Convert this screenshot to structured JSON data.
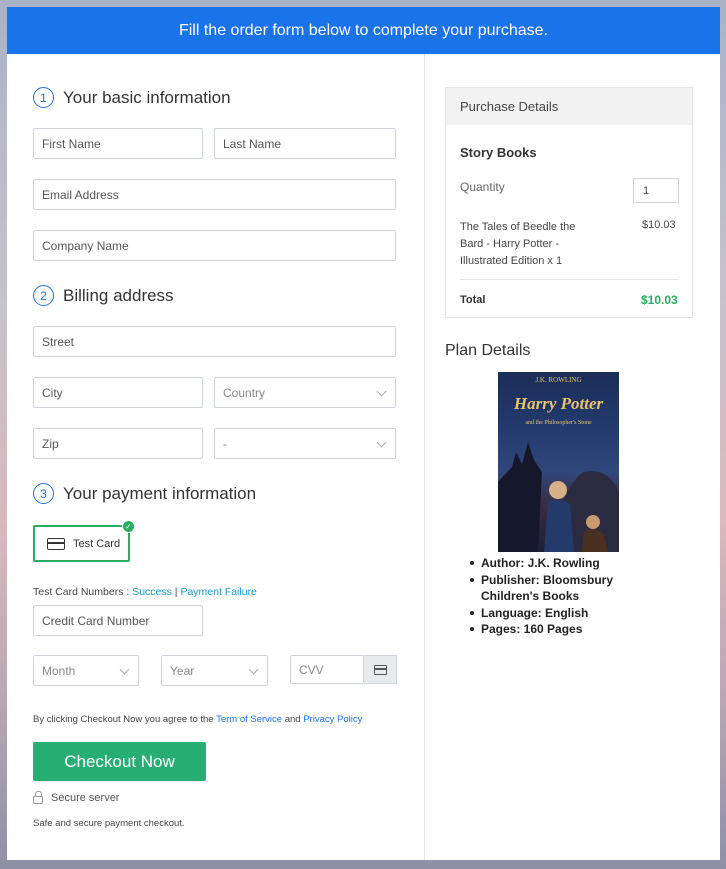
{
  "banner": {
    "text": "Fill the order form below to complete your purchase."
  },
  "form": {
    "section1": {
      "number": "1",
      "title": "Your basic information"
    },
    "first_name": {
      "placeholder": "First Name"
    },
    "last_name": {
      "placeholder": "Last Name"
    },
    "email": {
      "placeholder": "Email Address"
    },
    "company": {
      "placeholder": "Company Name"
    },
    "section2": {
      "number": "2",
      "title": "Billing address"
    },
    "street": {
      "placeholder": "Street"
    },
    "city": {
      "placeholder": "City"
    },
    "country": {
      "value": "Country"
    },
    "zip": {
      "placeholder": "Zip"
    },
    "state": {
      "value": "-"
    },
    "section3": {
      "number": "3",
      "title": "Your payment information"
    },
    "payment_option": {
      "label": "Test Card"
    },
    "test_card": {
      "prefix": "Test Card Numbers : ",
      "success": "Success",
      "separator": " | ",
      "failure": "Payment Failure"
    },
    "card_number": {
      "placeholder": "Credit Card Number"
    },
    "month": {
      "value": "Month"
    },
    "year": {
      "value": "Year"
    },
    "cvv": {
      "placeholder": "CVV"
    },
    "terms": {
      "prefix": "By clicking Checkout Now you agree to the ",
      "tos": "Term of Service",
      "and": " and ",
      "privacy": "Privacy Policy"
    },
    "checkout_label": "Checkout Now",
    "secure_label": "Secure server",
    "footer": "Safe and secure payment checkout."
  },
  "purchase": {
    "header": "Purchase Details",
    "product": "Story Books",
    "quantity_label": "Quantity",
    "quantity": "1",
    "item_line1": "The Tales of Beedle the",
    "item_line2": "Bard - Harry Potter -",
    "item_line3": "Illustrated Edition x 1",
    "item_price": "$10.03",
    "total_label": "Total",
    "total": "$10.03",
    "total_color": "#27ae60"
  },
  "plan": {
    "title": "Plan Details",
    "cover": {
      "author": "J.K. ROWLING",
      "title": "Harry Potter",
      "subtitle": "and the Philosopher's Stone"
    },
    "specs": [
      "Author: J.K. Rowling",
      "Publisher: Bloomsbury Children's Books",
      "Language: English",
      "Pages: 160 Pages"
    ]
  },
  "colors": {
    "accent": "#1a73e8",
    "success": "#27ae72"
  }
}
